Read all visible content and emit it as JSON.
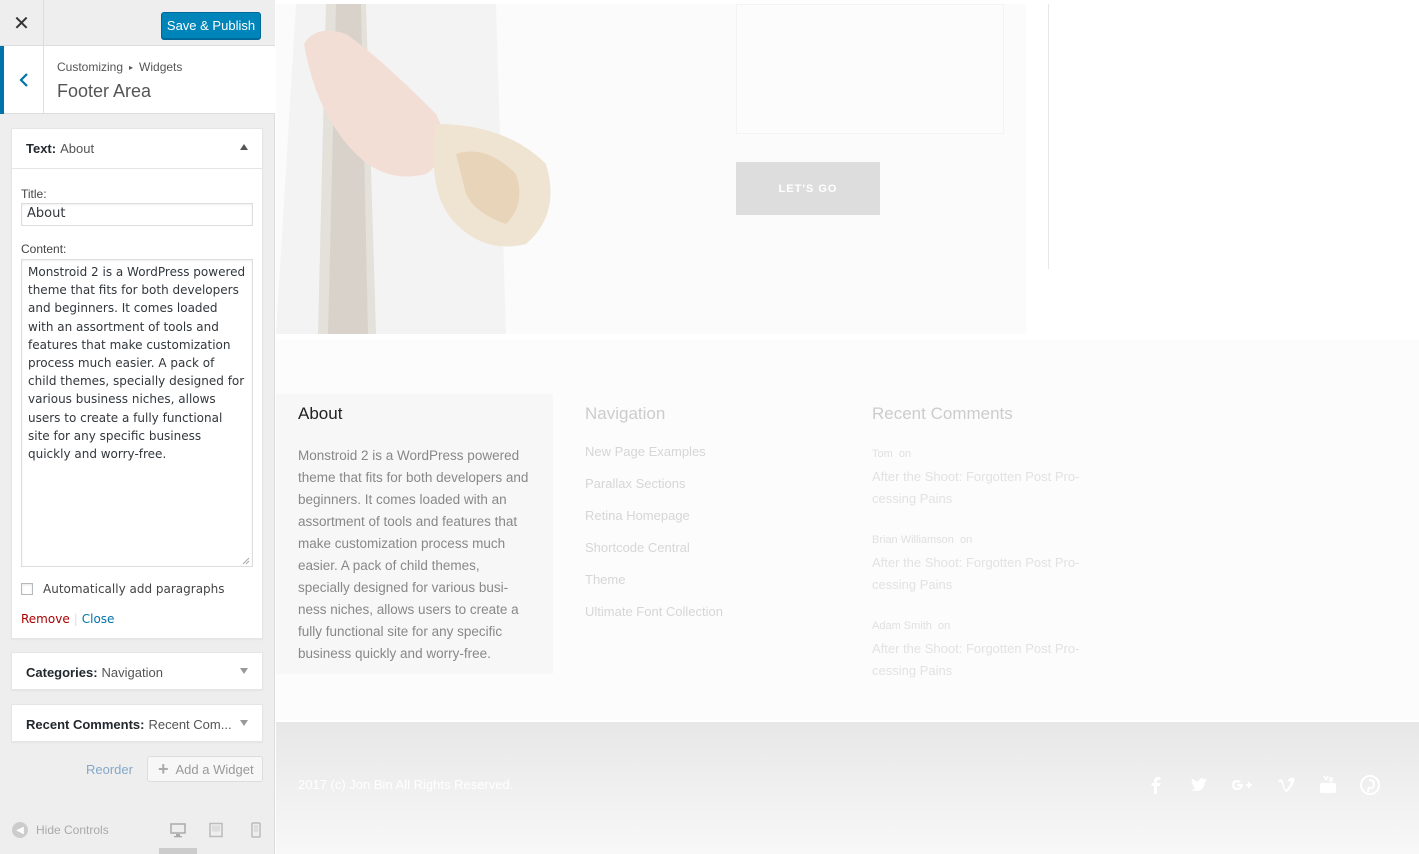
{
  "topbar": {
    "close_label": "✕",
    "publish_label": "Save & Publish"
  },
  "section": {
    "crumb_root": "Customizing",
    "crumb_sep": "▸",
    "crumb_child": "Widgets",
    "title": "Footer Area"
  },
  "widget_text": {
    "type_label": "Text:",
    "name": "About",
    "title_label": "Title:",
    "title_value": "About",
    "content_label": "Content:",
    "content_value": "Monstroid 2 is a WordPress powered theme that fits for both developers and beginners. It comes loaded with an assortment of tools and features that make customization process much easier. A pack of child themes, specially designed for various business niches, allows users to create a fully functional site for any specific business quickly and worry-free.",
    "auto_paragraphs_label": "Automatically add paragraphs",
    "remove_label": "Remove",
    "separator": "|",
    "close_label": "Close"
  },
  "widget_categories": {
    "type_label": "Categories:",
    "name": "Navigation"
  },
  "widget_recent": {
    "type_label": "Recent Comments:",
    "name": "Recent Com..."
  },
  "actions": {
    "reorder_label": "Reorder",
    "add_widget_label": "Add a Widget"
  },
  "footer_controls": {
    "hide_label": "Hide Controls"
  },
  "preview": {
    "lets_go_label": "LET'S GO",
    "about": {
      "title": "About",
      "body": "Monstroid 2 is a WordPress powered theme that fits for both developers and beginners. It comes loaded with an assortment of tools and features that make customization process much easier. A pack of child themes, specially designed for various busi-ness niches, allows users to create a fully functional site for any specific business quickly and worry-free."
    },
    "navigation": {
      "title": "Navigation",
      "links": [
        "New Page Examples",
        "Parallax Sections",
        "Retina Homepage",
        "Shortcode Central",
        "Theme",
        "Ultimate Font Collection"
      ]
    },
    "recent_comments": {
      "title": "Recent Comments",
      "items": [
        {
          "author": "Tom",
          "on": "on",
          "post": "After the Shoot: Forgotten Post Pro-cessing Pains"
        },
        {
          "author": "Brian Williamson",
          "on": "on",
          "post": "After the Shoot: Forgotten Post Pro-cessing Pains"
        },
        {
          "author": "Adam Smith",
          "on": "on",
          "post": "After the Shoot: Forgotten Post Pro-cessing Pains"
        }
      ]
    },
    "copyright": "2017 (c) Jon Bin All Rights Reserved.",
    "social_icons": [
      "facebook-icon",
      "twitter-icon",
      "google-plus-icon",
      "vimeo-icon",
      "youtube-icon",
      "pinterest-icon"
    ]
  },
  "colors": {
    "primary": "#0085ba",
    "link": "#0073aa",
    "remove": "#aa0000"
  }
}
